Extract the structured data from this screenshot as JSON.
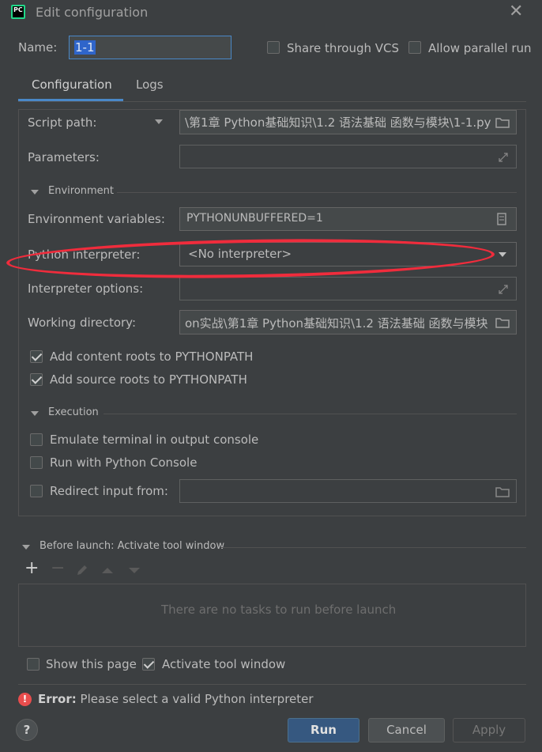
{
  "window": {
    "title": "Edit configuration",
    "app_icon_text": "PC"
  },
  "header": {
    "name_label": "Name:",
    "name_value": "1-1",
    "share_vcs_label": "Share through VCS",
    "parallel_label": "Allow parallel run"
  },
  "tabs": {
    "configuration": "Configuration",
    "logs": "Logs"
  },
  "form": {
    "script_path_label": "Script path:",
    "script_path_value": "\\第1章  Python基础知识\\1.2 语法基础 函数与模块\\1-1.py",
    "parameters_label": "Parameters:",
    "environment_section": "Environment",
    "env_vars_label": "Environment variables:",
    "env_vars_value": "PYTHONUNBUFFERED=1",
    "interpreter_label": "Python interpreter:",
    "interpreter_value": "<No interpreter>",
    "interp_options_label": "Interpreter options:",
    "working_dir_label": "Working directory:",
    "working_dir_value": "on实战\\第1章  Python基础知识\\1.2 语法基础 函数与模块",
    "content_roots_label": "Add content roots to PYTHONPATH",
    "source_roots_label": "Add source roots to PYTHONPATH",
    "execution_section": "Execution",
    "emulate_terminal_label": "Emulate terminal in output console",
    "python_console_label": "Run with Python Console",
    "redirect_label": "Redirect input from:"
  },
  "before_launch": {
    "title": "Before launch: Activate tool window",
    "empty_text": "There are no tasks to run before launch",
    "add_glyph": "+",
    "remove_glyph": "−"
  },
  "bottom": {
    "show_page_label": "Show this page",
    "activate_label": "Activate tool window",
    "error_prefix": "Error:",
    "error_message": " Please select a valid Python interpreter",
    "help_glyph": "?",
    "run_label": "Run",
    "cancel_label": "Cancel",
    "apply_label": "Apply"
  },
  "colors": {
    "accent": "#4a88c7",
    "error": "#e84d4d",
    "annotation": "#f02c3c"
  }
}
